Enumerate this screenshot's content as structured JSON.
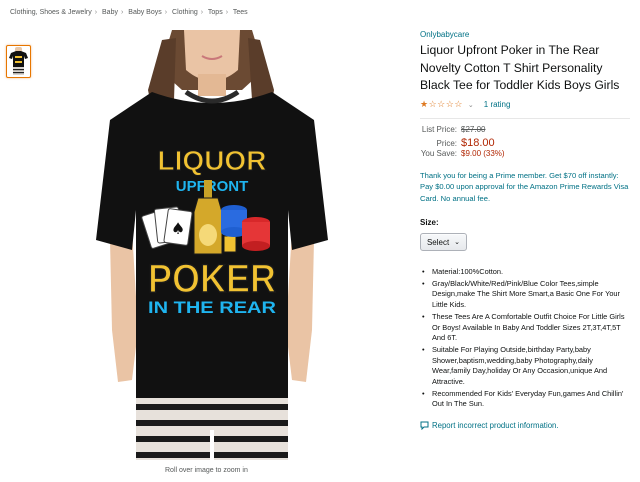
{
  "breadcrumb": [
    "Clothing, Shoes & Jewelry",
    "Baby",
    "Baby Boys",
    "Clothing",
    "Tops",
    "Tees"
  ],
  "breadcrumb_separator": "›",
  "gallery": {
    "zoom_hint": "Roll over image to zoom in"
  },
  "shirt_graphic": {
    "line1": "LIQUOR",
    "line2": "UPFRONT",
    "line3": "POKER",
    "line4": "IN THE REAR"
  },
  "product": {
    "brand": "Onlybabycare",
    "title": "Liquor Upfront Poker in The Rear Novelty Cotton T Shirt Personality Black Tee for Toddler Kids Boys Girls",
    "rating_stars": 1,
    "rating_out_of": 5,
    "rating_chevron": "⌄",
    "rating_count": "1 rating"
  },
  "pricing": {
    "list_label": "List Price:",
    "list_value": "$27.00",
    "price_label": "Price:",
    "price_value": "$18.00",
    "save_label": "You Save:",
    "save_value": "$9.00 (33%)"
  },
  "prime_offer": "Thank you for being a Prime member. Get $70 off instantly: Pay $0.00 upon approval for the Amazon Prime Rewards Visa Card. No annual fee.",
  "size": {
    "label": "Size:",
    "select_value": "Select",
    "caret": "⌄"
  },
  "features": [
    "Material:100%Cotton.",
    "Gray/Black/White/Red/Pink/Blue Color Tees,simple Design,make The Shirt More Smart,a Basic One For Your Little Kids.",
    "These Tees Are A Comfortable Outfit Choice For Little Girls Or Boys! Available In Baby And Toddler Sizes 2T,3T,4T,5T And 6T.",
    "Suitable For Playing Outside,birthday Party,baby Shower,baptism,wedding,baby Photography,daily Wear,family Day,holiday Or Any Occasion,unique And Attractive.",
    "Recommended For Kids' Everyday Fun,games And Chillin' Out In The Sun."
  ],
  "report_link": "Report incorrect product information.",
  "colors": {
    "link": "#007185",
    "price": "#b12704",
    "star": "#de7921",
    "shirt": "#111111",
    "gold": "#f1c232",
    "cyan": "#1fb4ef"
  }
}
